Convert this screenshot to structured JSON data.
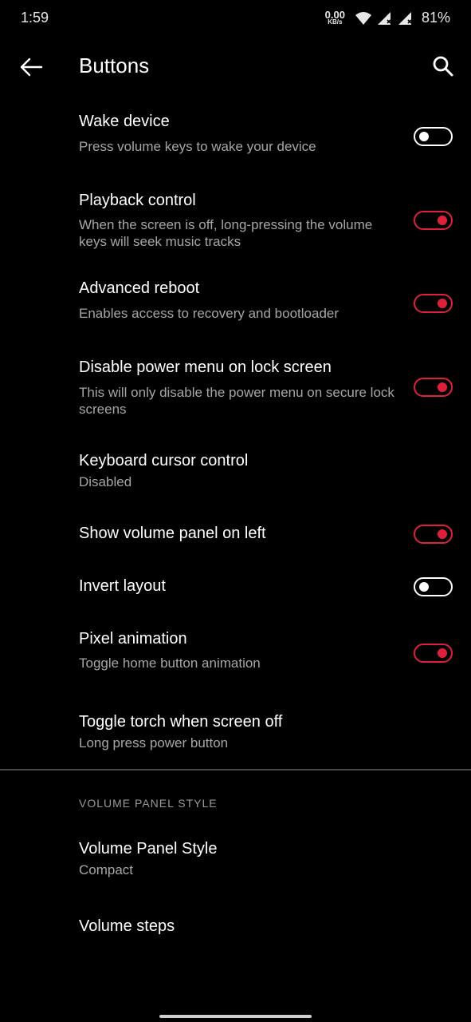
{
  "status_bar": {
    "time": "1:59",
    "net_speed_value": "0.00",
    "net_speed_unit": "KB/s",
    "battery": "81%"
  },
  "app_bar": {
    "title": "Buttons",
    "back_icon": "arrow-left-icon",
    "search_icon": "search-icon"
  },
  "settings": [
    {
      "title": "Wake device",
      "summary": "Press volume keys to wake your device",
      "toggle": "off"
    },
    {
      "title": "Playback control",
      "summary": "When the screen is off, long-pressing the volume keys will seek music tracks",
      "toggle": "on"
    },
    {
      "title": "Advanced reboot",
      "summary": "Enables access to recovery and bootloader",
      "toggle": "on"
    },
    {
      "title": "Disable power menu on lock screen",
      "summary": "This will only disable the power menu on secure lock screens",
      "toggle": "on"
    },
    {
      "title": "Keyboard cursor control",
      "summary": "Disabled"
    },
    {
      "title": "Show volume panel on left",
      "toggle": "on"
    },
    {
      "title": "Invert layout",
      "toggle": "off"
    },
    {
      "title": "Pixel animation",
      "summary": "Toggle home button animation",
      "toggle": "on"
    },
    {
      "title": "Toggle torch when screen off",
      "summary": "Long press power button"
    }
  ],
  "section_header": "VOLUME PANEL STYLE",
  "volume_settings": [
    {
      "title": "Volume Panel Style",
      "summary": "Compact"
    },
    {
      "title": "Volume steps"
    }
  ],
  "colors": {
    "accent": "#e0203a",
    "background": "#000000"
  }
}
